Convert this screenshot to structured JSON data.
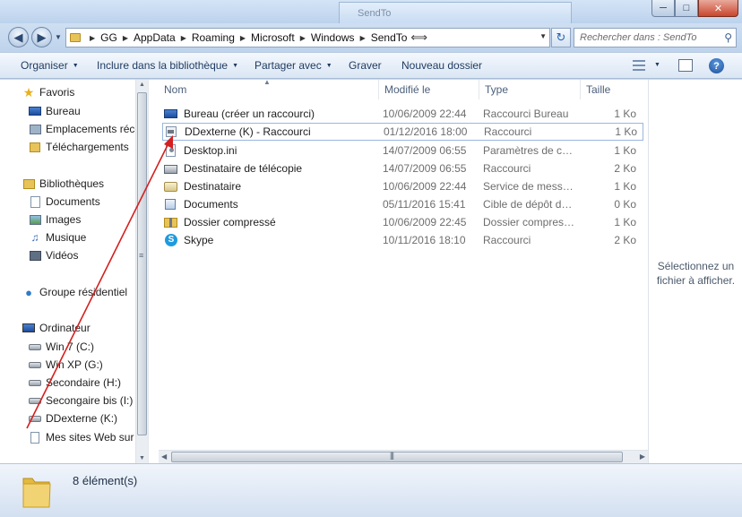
{
  "window": {
    "background_title": "SendTo",
    "min_label": "─",
    "max_label": "□",
    "close_label": "✕"
  },
  "address": {
    "crumbs": [
      "GG",
      "AppData",
      "Roaming",
      "Microsoft",
      "Windows",
      "SendTo"
    ],
    "search_placeholder": "Rechercher dans : SendTo"
  },
  "toolbar": {
    "organize": "Organiser",
    "include": "Inclure dans la bibliothèque",
    "share": "Partager avec",
    "burn": "Graver",
    "new_folder": "Nouveau dossier"
  },
  "nav": {
    "favorites": {
      "label": "Favoris",
      "items": [
        "Bureau",
        "Emplacements récents",
        "Téléchargements"
      ]
    },
    "libraries": {
      "label": "Bibliothèques",
      "items": [
        "Documents",
        "Images",
        "Musique",
        "Vidéos"
      ]
    },
    "homegroup": {
      "label": "Groupe résidentiel"
    },
    "computer": {
      "label": "Ordinateur",
      "items": [
        "Win 7 (C:)",
        "Win XP (G:)",
        "Secondaire (H:)",
        "Secongaire bis (I:)",
        "DDexterne (K:)",
        "Mes sites Web sur MSN"
      ]
    }
  },
  "columns": {
    "name": "Nom",
    "date": "Modifié le",
    "type": "Type",
    "size": "Taille"
  },
  "files": [
    {
      "name": "Bureau (créer un raccourci)",
      "date": "10/06/2009 22:44",
      "type": "Raccourci Bureau",
      "size": "1 Ko",
      "icon": "desktop-icon"
    },
    {
      "name": "DDexterne (K) - Raccourci",
      "date": "01/12/2016 18:00",
      "type": "Raccourci",
      "size": "1 Ko",
      "icon": "drive-shortcut-icon"
    },
    {
      "name": "Desktop.ini",
      "date": "14/07/2009 06:55",
      "type": "Paramètres de con...",
      "size": "1 Ko",
      "icon": "settings-file-icon"
    },
    {
      "name": "Destinataire de télécopie",
      "date": "14/07/2009 06:55",
      "type": "Raccourci",
      "size": "2 Ko",
      "icon": "fax-icon"
    },
    {
      "name": "Destinataire",
      "date": "10/06/2009 22:44",
      "type": "Service de messag...",
      "size": "1 Ko",
      "icon": "mail-icon"
    },
    {
      "name": "Documents",
      "date": "05/11/2016 15:41",
      "type": "Cible de dépôt de ...",
      "size": "0 Ko",
      "icon": "documents-icon"
    },
    {
      "name": "Dossier compressé",
      "date": "10/06/2009 22:45",
      "type": "Dossier compressé...",
      "size": "1 Ko",
      "icon": "zip-folder-icon"
    },
    {
      "name": "Skype",
      "date": "10/11/2016 18:10",
      "type": "Raccourci",
      "size": "2 Ko",
      "icon": "skype-icon"
    }
  ],
  "preview": {
    "message": "Sélectionnez un fichier à afficher."
  },
  "status": {
    "count": "8 élément(s)"
  },
  "colors": {
    "annotation_arrow": "#d42020",
    "selection_border": "#98b7de",
    "accent": "#1e3a5f"
  }
}
